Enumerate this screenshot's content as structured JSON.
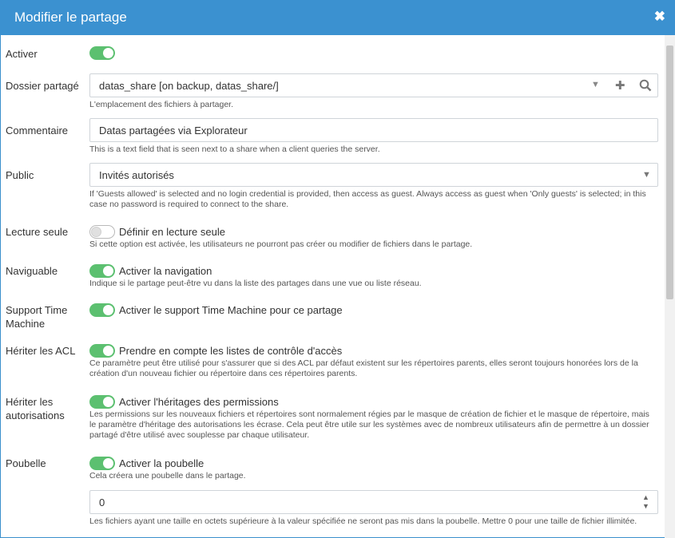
{
  "dialog": {
    "title": "Modifier le partage",
    "close_icon": "✖"
  },
  "rows": {
    "activer": {
      "label": "Activer",
      "enabled": true
    },
    "dossier": {
      "label": "Dossier partagé",
      "value": "datas_share [on backup, datas_share/]",
      "help": "L'emplacement des fichiers à partager."
    },
    "commentaire": {
      "label": "Commentaire",
      "value": "Datas partagées via Explorateur",
      "help": "This is a text field that is seen next to a share when a client queries the server."
    },
    "public": {
      "label": "Public",
      "value": "Invités autorisés",
      "help": "If 'Guests allowed' is selected and no login credential is provided, then access as guest. Always access as guest when 'Only guests' is selected; in this case no password is required to connect to the share."
    },
    "lecture": {
      "label": "Lecture seule",
      "toggle_label": "Définir en lecture seule",
      "enabled": false,
      "help": "Si cette option est activée, les utilisateurs ne pourront pas créer ou modifier de fichiers dans le partage."
    },
    "naviguable": {
      "label": "Naviguable",
      "toggle_label": "Activer la navigation",
      "enabled": true,
      "help": "Indique si le partage peut-être vu dans la liste des partages dans une vue ou liste réseau."
    },
    "timemachine": {
      "label": "Support Time Machine",
      "toggle_label": "Activer le support Time Machine pour ce partage",
      "enabled": true
    },
    "acl": {
      "label": "Hériter les ACL",
      "toggle_label": "Prendre en compte les listes de contrôle d'accès",
      "enabled": true,
      "help": "Ce paramètre peut être utilisé pour s'assurer que si des ACL par défaut existent sur les répertoires parents, elles seront toujours honorées lors de la création d'un nouveau fichier ou répertoire dans ces répertoires parents."
    },
    "autorisations": {
      "label": "Hériter les autorisations",
      "toggle_label": "Activer l'héritages des permissions",
      "enabled": true,
      "help": "Les permissions sur les nouveaux fichiers et répertoires sont normalement régies par le masque de création de fichier et le masque de répertoire, mais le paramètre d'héritage des autorisations les écrase. Cela peut être utile sur les systèmes avec de nombreux utilisateurs afin de permettre à un dossier partagé d'être utilisé avec souplesse par chaque utilisateur."
    },
    "poubelle": {
      "label": "Poubelle",
      "toggle_label": "Activer la poubelle",
      "enabled": true,
      "help": "Cela créera une poubelle dans le partage.",
      "size_value": "0",
      "size_help": "Les fichiers ayant une taille en octets supérieure à la valeur spécifiée ne seront pas mis dans la poubelle. Mettre 0 pour une taille de fichier illimitée."
    }
  },
  "icons": {
    "caret": "▼",
    "plus": "✚",
    "search": "search-icon",
    "spinner_up": "▲",
    "spinner_down": "▼"
  }
}
